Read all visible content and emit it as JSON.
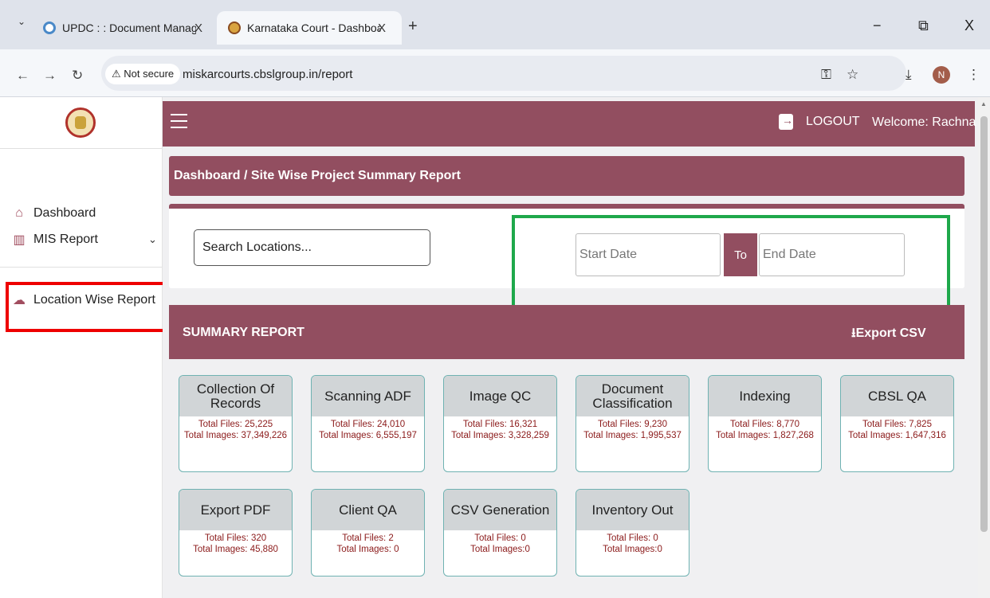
{
  "browser": {
    "tabs": [
      {
        "label": "UPDC : : Document Managemen",
        "active": false
      },
      {
        "label": "Karnataka Court - Dashboard",
        "active": true
      }
    ],
    "tab_close": "X",
    "new_tab": "+",
    "window_controls": {
      "minimize": "−",
      "maximize": "⧉",
      "close": "X"
    },
    "security_badge": "⚠ Not secure",
    "url": "miskarcourts.cbslgroup.in/report",
    "profile_initial": "N"
  },
  "sidebar": {
    "items": [
      {
        "label": "Dashboard",
        "icon": "home-icon"
      },
      {
        "label": "MIS Report",
        "icon": "chart-bar-icon"
      },
      {
        "label": "Location Wise Report",
        "icon": "cloud-upload-icon"
      }
    ]
  },
  "header": {
    "logout_label": "LOGOUT",
    "welcome_text": "Welcome: Rachna"
  },
  "breadcrumb": "Dashboard / Site Wise Project Summary Report",
  "filters": {
    "search_placeholder": "Search Locations...",
    "start_placeholder": "Start Date",
    "to_label": "To",
    "end_placeholder": "End Date"
  },
  "summary": {
    "title": "SUMMARY REPORT",
    "export_label": "Export CSV"
  },
  "cards": [
    {
      "title": "Collection Of Records",
      "files": "Total Files: 25,225",
      "images": "Total Images: 37,349,226"
    },
    {
      "title": "Scanning ADF",
      "files": "Total Files: 24,010",
      "images": "Total Images: 6,555,197"
    },
    {
      "title": "Image QC",
      "files": "Total Files: 16,321",
      "images": "Total Images: 3,328,259"
    },
    {
      "title": "Document Classification",
      "files": "Total Files: 9,230",
      "images": "Total Images: 1,995,537"
    },
    {
      "title": "Indexing",
      "files": "Total Files: 8,770",
      "images": "Total Images: 1,827,268"
    },
    {
      "title": "CBSL QA",
      "files": "Total Files: 7,825",
      "images": "Total Images: 1,647,316"
    },
    {
      "title": "Export PDF",
      "files": "Total Files: 320",
      "images": "Total Images: 45,880"
    },
    {
      "title": "Client QA",
      "files": "Total Files: 2",
      "images": "Total Images: 0"
    },
    {
      "title": "CSV Generation",
      "files": "Total Files: 0",
      "images": "Total Images:0"
    },
    {
      "title": "Inventory Out",
      "files": "Total Files: 0",
      "images": "Total Images:0"
    }
  ],
  "colors": {
    "brand": "#924e60",
    "highlight_red": "#ee0000",
    "highlight_green": "#1ea84b"
  }
}
